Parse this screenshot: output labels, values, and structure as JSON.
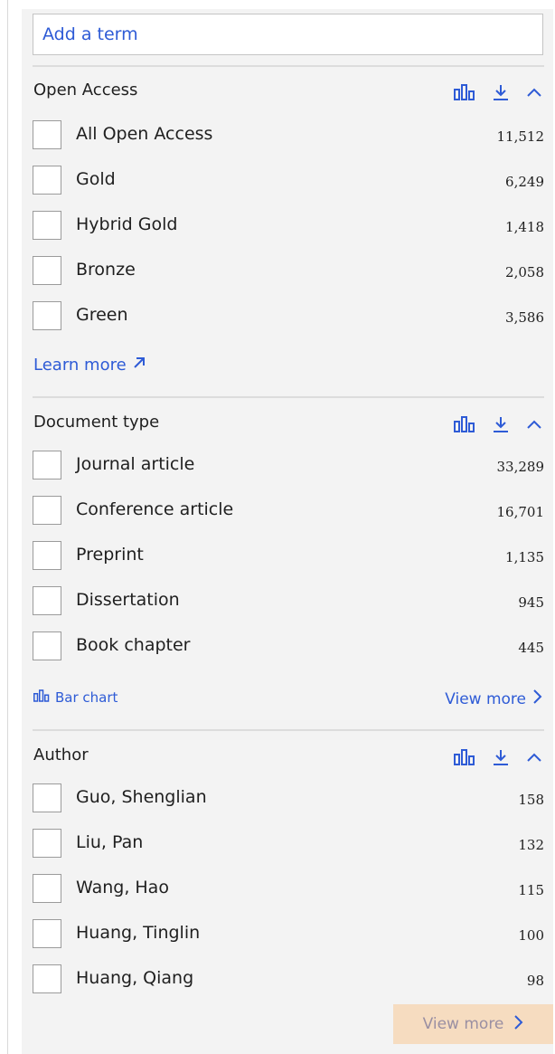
{
  "search": {
    "placeholder": "Add a term"
  },
  "colors": {
    "accent": "#2e5bd6",
    "panel_bg": "#f3f3f3",
    "highlight": "#f6dcc0"
  },
  "icons": {
    "chart": "bar-chart-icon",
    "download": "download-icon",
    "collapse": "chevron-up-icon",
    "external": "arrow-up-right-icon",
    "next": "chevron-right-icon"
  },
  "open_access": {
    "title": "Open Access",
    "items": [
      {
        "label": "All Open Access",
        "count": "11,512"
      },
      {
        "label": "Gold",
        "count": "6,249"
      },
      {
        "label": "Hybrid Gold",
        "count": "1,418"
      },
      {
        "label": "Bronze",
        "count": "2,058"
      },
      {
        "label": "Green",
        "count": "3,586"
      }
    ],
    "learn_more": "Learn more"
  },
  "document_type": {
    "title": "Document type",
    "items": [
      {
        "label": "Journal article",
        "count": "33,289"
      },
      {
        "label": "Conference article",
        "count": "16,701"
      },
      {
        "label": "Preprint",
        "count": "1,135"
      },
      {
        "label": "Dissertation",
        "count": "945"
      },
      {
        "label": "Book chapter",
        "count": "445"
      }
    ],
    "bar_chart": "Bar chart",
    "view_more": "View more"
  },
  "author": {
    "title": "Author",
    "items": [
      {
        "label": "Guo, Shenglian",
        "count": "158"
      },
      {
        "label": "Liu, Pan",
        "count": "132"
      },
      {
        "label": "Wang, Hao",
        "count": "115"
      },
      {
        "label": "Huang, Tinglin",
        "count": "100"
      },
      {
        "label": "Huang, Qiang",
        "count": "98"
      }
    ],
    "view_more": "View more"
  }
}
